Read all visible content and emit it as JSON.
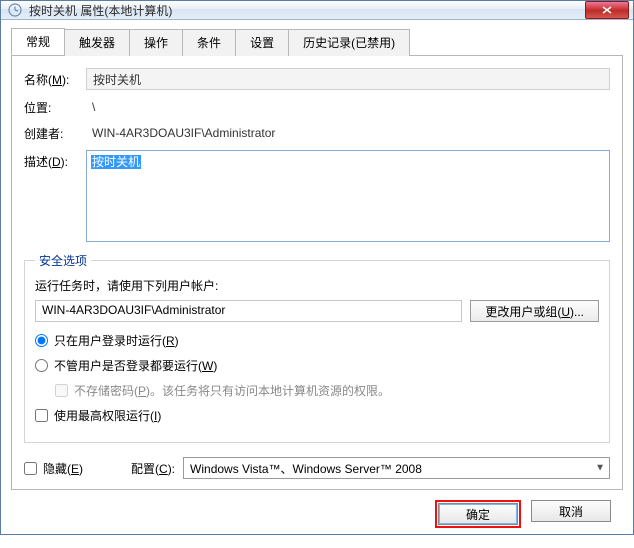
{
  "titlebar": {
    "title": "按时关机 属性(本地计算机)"
  },
  "tabs": {
    "general": "常规",
    "triggers": "触发器",
    "actions": "操作",
    "conditions": "条件",
    "settings": "设置",
    "history": "历史记录(已禁用)"
  },
  "general": {
    "name_label_pre": "名称(",
    "name_label_u": "M",
    "name_label_post": "):",
    "name_value": "按时关机",
    "location_label": "位置:",
    "location_value": "\\",
    "creator_label": "创建者:",
    "creator_value": "WIN-4AR3DOAU3IF\\Administrator",
    "desc_label_pre": "描述(",
    "desc_label_u": "D",
    "desc_label_post": "):",
    "desc_value": "按时关机"
  },
  "security": {
    "legend": "安全选项",
    "run_as_line": "运行任务时，请使用下列用户帐户:",
    "account": "WIN-4AR3DOAU3IF\\Administrator",
    "change_user_pre": "更改用户或组(",
    "change_user_u": "U",
    "change_user_post": ")...",
    "radio1_pre": "只在用户登录时运行(",
    "radio1_u": "R",
    "radio1_post": ")",
    "radio2_pre": "不管用户是否登录都要运行(",
    "radio2_u": "W",
    "radio2_post": ")",
    "nostore_pre": "不存储密码(",
    "nostore_u": "P",
    "nostore_post": ")。该任务将只有访问本地计算机资源的权限。",
    "highest_pre": "使用最高权限运行(",
    "highest_u": "I",
    "highest_post": ")"
  },
  "bottom": {
    "hidden_pre": "隐藏(",
    "hidden_u": "E",
    "hidden_post": ")",
    "config_pre": "配置(",
    "config_u": "C",
    "config_post": "):",
    "config_value": "Windows Vista™、Windows Server™ 2008"
  },
  "footer": {
    "ok": "确定",
    "cancel": "取消"
  }
}
